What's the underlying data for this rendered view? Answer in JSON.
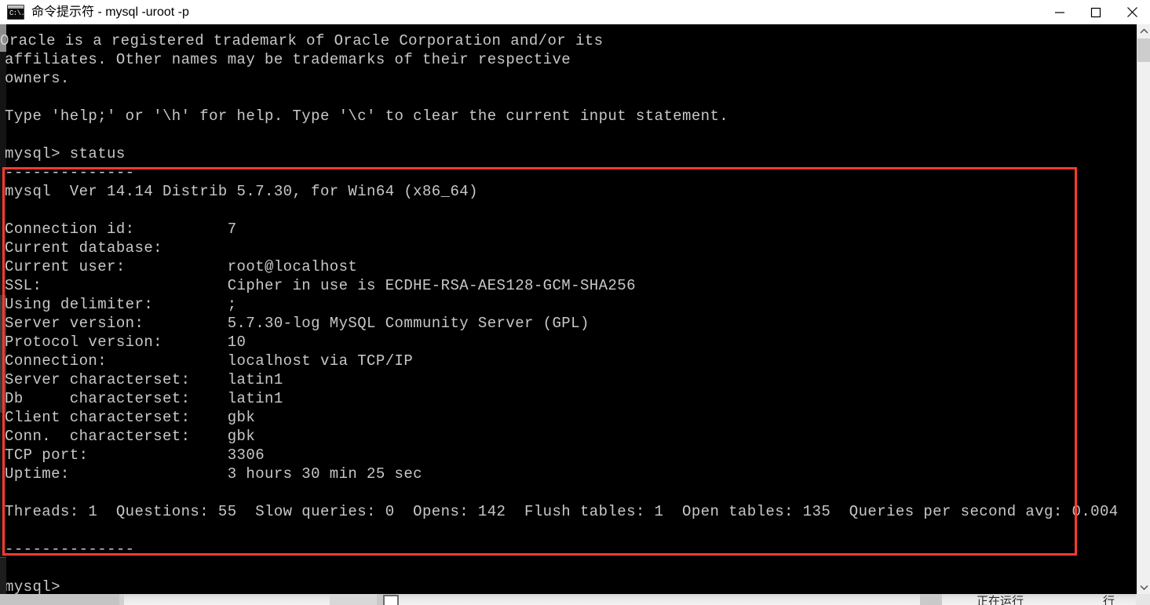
{
  "window": {
    "title": "命令提示符 - mysql  -uroot -p",
    "icon": "cmd-icon",
    "icon_text": "C:\\.",
    "controls": {
      "minimize": "minimize-icon",
      "maximize": "maximize-icon",
      "close": "close-icon"
    }
  },
  "terminal": {
    "background_color": "#000000",
    "text_color": "#c8c8c8",
    "prompt": "mysql>",
    "content": "Oracle is a registered trademark of Oracle Corporation and/or its\naffiliates. Other names may be trademarks of their respective\nowners.\n\nType 'help;' or '\\h' for help. Type '\\c' to clear the current input statement.\n\nmysql> status\n--------------\nmysql  Ver 14.14 Distrib 5.7.30, for Win64 (x86_64)\n\nConnection id:          7\nCurrent database:\nCurrent user:           root@localhost\nSSL:                    Cipher in use is ECDHE-RSA-AES128-GCM-SHA256\nUsing delimiter:        ;\nServer version:         5.7.30-log MySQL Community Server (GPL)\nProtocol version:       10\nConnection:             localhost via TCP/IP\nServer characterset:    latin1\nDb     characterset:    latin1\nClient characterset:    gbk\nConn.  characterset:    gbk\nTCP port:               3306\nUptime:                 3 hours 30 min 25 sec\n\nThreads: 1  Questions: 55  Slow queries: 0  Opens: 142  Flush tables: 1  Open tables: 135  Queries per second avg: 0.004\n\n--------------\n\nmysql>",
    "banner_lines": [
      "Oracle is a registered trademark of Oracle Corporation and/or its",
      "affiliates. Other names may be trademarks of their respective",
      "owners.",
      "Type 'help;' or '\\h' for help. Type '\\c' to clear the current input statement."
    ],
    "command": "status",
    "separator": "--------------",
    "version_line": "mysql  Ver 14.14 Distrib 5.7.30, for Win64 (x86_64)",
    "status_rows": [
      {
        "label": "Connection id:",
        "value": "7"
      },
      {
        "label": "Current database:",
        "value": ""
      },
      {
        "label": "Current user:",
        "value": "root@localhost"
      },
      {
        "label": "SSL:",
        "value": "Cipher in use is ECDHE-RSA-AES128-GCM-SHA256"
      },
      {
        "label": "Using delimiter:",
        "value": ";"
      },
      {
        "label": "Server version:",
        "value": "5.7.30-log MySQL Community Server (GPL)"
      },
      {
        "label": "Protocol version:",
        "value": "10"
      },
      {
        "label": "Connection:",
        "value": "localhost via TCP/IP"
      },
      {
        "label": "Server characterset:",
        "value": "latin1"
      },
      {
        "label": "Db     characterset:",
        "value": "latin1"
      },
      {
        "label": "Client characterset:",
        "value": "gbk"
      },
      {
        "label": "Conn.  characterset:",
        "value": "gbk"
      },
      {
        "label": "TCP port:",
        "value": "3306"
      },
      {
        "label": "Uptime:",
        "value": "3 hours 30 min 25 sec"
      }
    ],
    "stats_line": "Threads: 1  Questions: 55  Slow queries: 0  Opens: 142  Flush tables: 1  Open tables: 135  Queries per second avg: 0.004",
    "stats": {
      "threads": "1",
      "questions": "55",
      "slow_queries": "0",
      "opens": "142",
      "flush_tables": "1",
      "open_tables": "135",
      "queries_per_second_avg": "0.004"
    }
  },
  "annotation": {
    "type": "rectangle",
    "color": "#fb3b30"
  },
  "scrollbar": {
    "up_arrow": "chevron-up-icon",
    "down_arrow": "chevron-down-icon",
    "track_color": "#f0f0f0",
    "thumb_color": "#cdcdcd"
  },
  "taskbar": {
    "label_partial": "正在运行",
    "label_partial_2": "行"
  }
}
